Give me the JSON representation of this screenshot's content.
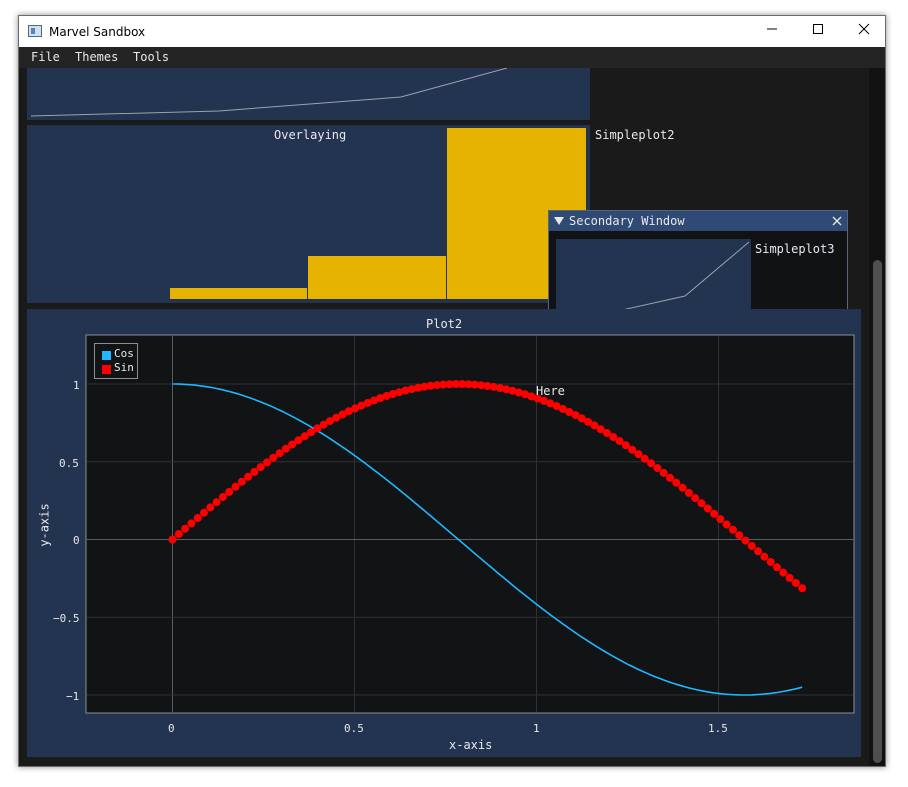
{
  "window": {
    "title": "Marvel Sandbox"
  },
  "menu": {
    "file": "File",
    "themes": "Themes",
    "tools": "Tools"
  },
  "overlay_plot": {
    "title": "Overlaying",
    "label": "Simpleplot2",
    "bar_color": "#e6b400",
    "bar_values": [
      1,
      3,
      9.5
    ],
    "line_values": [
      0.1,
      0.5,
      1.5,
      4
    ]
  },
  "secondary_window": {
    "title": "Secondary Window",
    "plot_label": "Simpleplot3",
    "line_values": [
      0.1,
      0.6,
      1.8,
      5
    ]
  },
  "plot2": {
    "title": "Plot2",
    "xlabel": "x-axis",
    "ylabel": "y-axis",
    "annotation": "Here",
    "x_ticks": [
      "0",
      "0.5",
      "1",
      "1.5"
    ],
    "y_ticks": [
      "1",
      "0.5",
      "0",
      "−0.5",
      "−1"
    ],
    "legend": [
      {
        "name": "Cos",
        "color": "#1fb7ff"
      },
      {
        "name": "Sin",
        "color": "#ff0000"
      }
    ]
  },
  "chart_data": {
    "type": "line",
    "title": "Plot2",
    "xlabel": "x-axis",
    "ylabel": "y-axis",
    "xlim": [
      -0.24,
      1.87
    ],
    "ylim": [
      -1.12,
      1.33
    ],
    "series": [
      {
        "name": "Cos",
        "function": "cos(2x)",
        "x_range": [
          0,
          1.73
        ],
        "style": "line",
        "color": "#1fb7ff"
      },
      {
        "name": "Sin",
        "function": "sin(2x)",
        "x_range": [
          0,
          1.73
        ],
        "style": "markers",
        "color": "#ff0000"
      }
    ],
    "annotations": [
      {
        "text": "Here",
        "x": 1.0,
        "y": 0.93
      }
    ],
    "legend_position": "top-left",
    "grid": true
  }
}
